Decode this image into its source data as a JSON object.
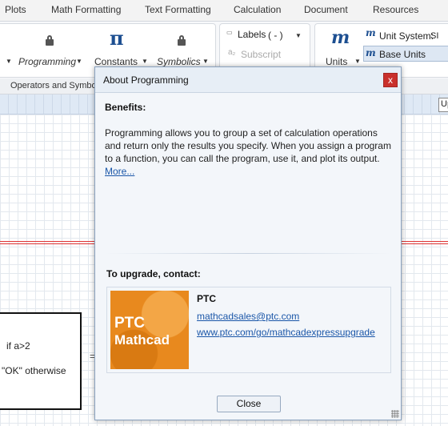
{
  "ribbon_tabs": [
    "Plots",
    "Math Formatting",
    "Text Formatting",
    "Calculation",
    "Document",
    "Resources"
  ],
  "ribbon": {
    "programming_label": "Programming",
    "constants_label": "Constants",
    "symbolics_label": "Symbolics",
    "labels_label": "Labels",
    "labels_value": "( - )",
    "subscript_label": "Subscript",
    "units_label": "Units",
    "unit_system_label": "Unit System:",
    "unit_system_value": "SI",
    "base_units_label": "Base Units",
    "group_label": "Operators and Symbols",
    "up_button": "Up"
  },
  "worksheet": {
    "line1": "if a>2",
    "line2": "\"OK\" otherwise",
    "equals": "="
  },
  "dialog": {
    "title": "About Programming",
    "close_x": "x",
    "benefits_heading": "Benefits:",
    "benefits_text": "Programming allows you to group a set of calculation operations and return only the results you specify. When you assign a program to a function, you can call the program, use it, and plot its output.",
    "more_link": "More...",
    "upgrade_heading": "To upgrade, contact:",
    "logo_line1": "PTC",
    "logo_line2": "Mathcad",
    "company": "PTC",
    "email": "mathcadsales@ptc.com",
    "url": "www.ptc.com/go/mathcadexpressupgrade",
    "close_button": "Close"
  }
}
